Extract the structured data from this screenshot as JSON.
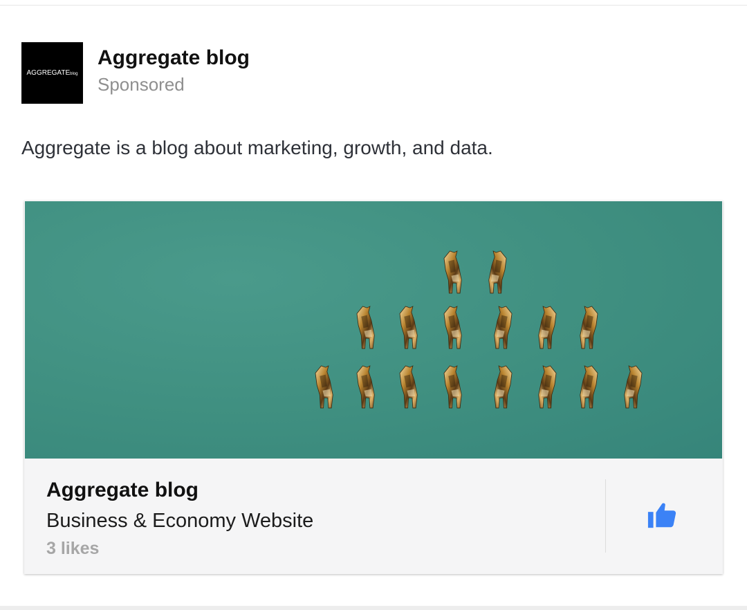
{
  "post": {
    "page_name": "Aggregate blog",
    "sponsored_label": "Sponsored",
    "avatar": {
      "logo_text": "AGGREGATE",
      "logo_suffix": "blog",
      "background": "#000000"
    },
    "text": "Aggregate is a blog about marketing, growth, and data."
  },
  "card": {
    "cover_image": {
      "description_icon": "origami-giraffes-pyramid",
      "background_color": "#3f8f80",
      "figure_color": "#c99a4a"
    },
    "title": "Aggregate blog",
    "category": "Business & Economy Website",
    "likes": "3 likes",
    "like_icon": "thumbs-up-icon",
    "accent_color": "#3b82f6"
  }
}
